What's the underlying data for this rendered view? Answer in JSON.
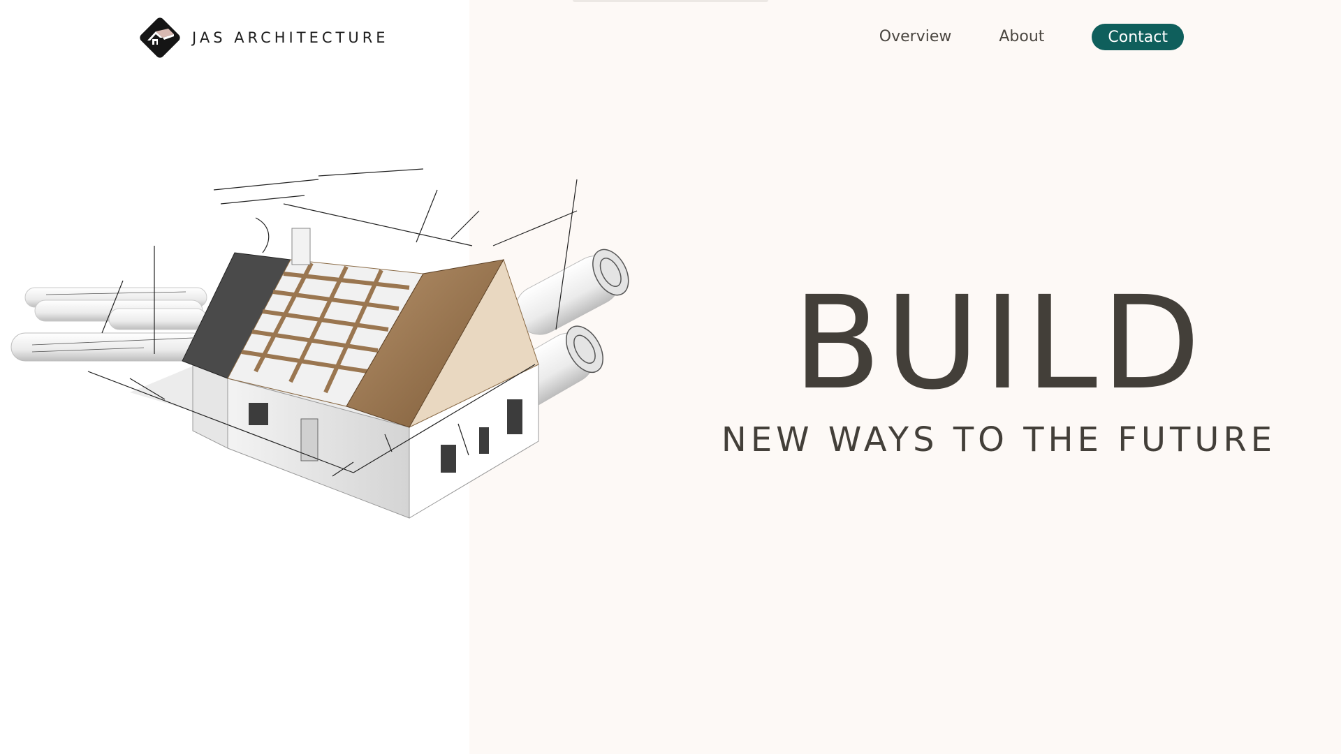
{
  "brand": {
    "name": "JAS ARCHITECTURE",
    "logo_icon": "house-roof-diamond-icon"
  },
  "nav": {
    "items": [
      {
        "label": "Overview"
      },
      {
        "label": "About"
      }
    ],
    "contact_label": "Contact"
  },
  "hero": {
    "title": "BUILD",
    "subtitle": "NEW WAYS TO THE FUTURE",
    "image_icon": "house-blueprint-illustration"
  },
  "colors": {
    "accent": "#0f5f5c",
    "text": "#433f39",
    "panel_background": "#fdf9f6",
    "page_background": "#ffffff"
  }
}
